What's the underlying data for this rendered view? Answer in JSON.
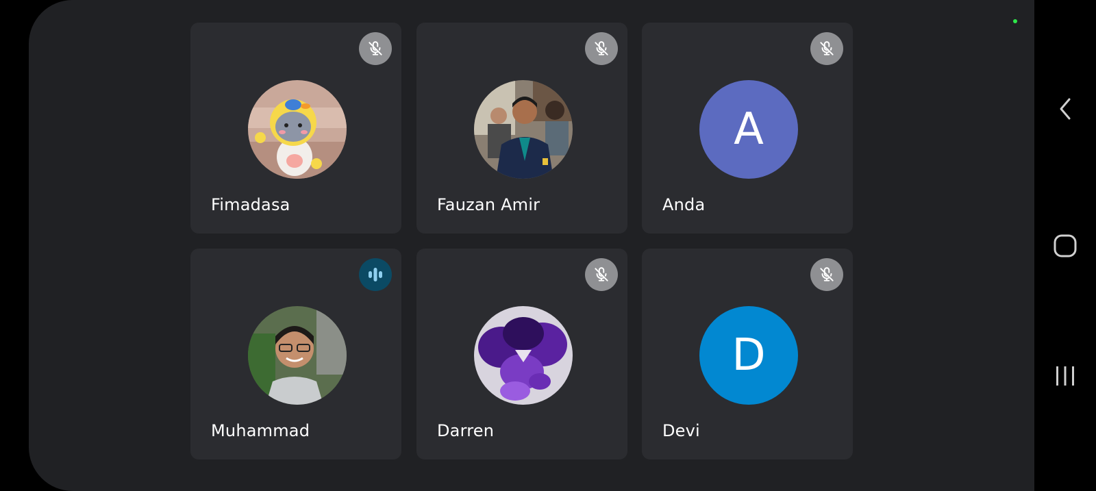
{
  "participants": [
    {
      "name": "Fimadasa",
      "status": "muted",
      "avatar": "photo-duck-figurine"
    },
    {
      "name": "Fauzan Amir",
      "status": "muted",
      "avatar": "photo-person-group"
    },
    {
      "name": "Anda",
      "status": "muted",
      "avatar_letter": "A",
      "avatar_color": "#5c6bc0"
    },
    {
      "name": "Muhammad",
      "status": "speaking",
      "avatar": "photo-person-glasses"
    },
    {
      "name": "Darren",
      "status": "muted",
      "avatar": "photo-purple-smoke"
    },
    {
      "name": "Devi",
      "status": "muted",
      "avatar_letter": "D",
      "avatar_color": "#0288d1"
    }
  ],
  "icons": {
    "muted": "mic-off-icon",
    "speaking": "audio-level-icon",
    "nav_back": "back-chevron-icon",
    "nav_home": "home-icon",
    "nav_recents": "recents-icon"
  },
  "colors": {
    "background": "#202124",
    "tile": "#2b2c30",
    "muted_badge": "#8f9093",
    "speaking_badge": "#0b4a64",
    "speaking_bars": "#8fd0f0",
    "status_dot": "#2ee84a"
  }
}
